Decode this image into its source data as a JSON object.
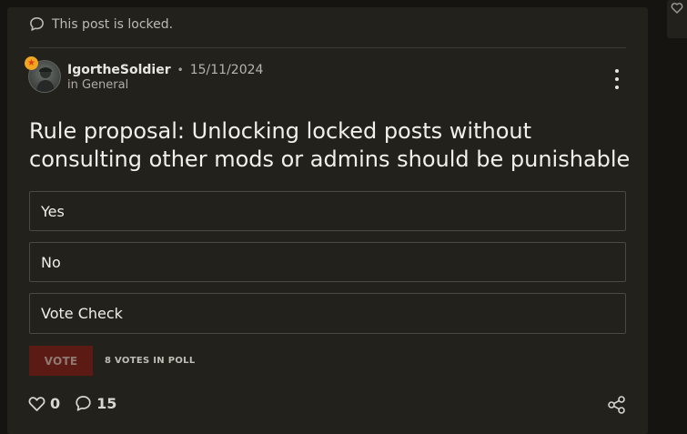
{
  "notice": {
    "icon": "comment-icon",
    "text": "This post is locked."
  },
  "post": {
    "author": {
      "username": "IgortheSoldier",
      "date": "15/11/2024",
      "category": "in General",
      "badge_icon": "star-badge-icon",
      "badge_color": "#f0a61f"
    },
    "title": "Rule proposal: Unlocking locked posts without consulting other mods or admins should be punishable",
    "poll": {
      "options": [
        {
          "label": "Yes"
        },
        {
          "label": "No"
        },
        {
          "label": "Vote Check"
        }
      ],
      "vote_label": "VOTE",
      "votes_text": "8 VOTES IN POLL"
    },
    "stats": {
      "likes": "0",
      "comments": "15"
    }
  },
  "colors": {
    "background": "#161411",
    "card": "#23211c",
    "vote_button": "#5c1a14"
  }
}
